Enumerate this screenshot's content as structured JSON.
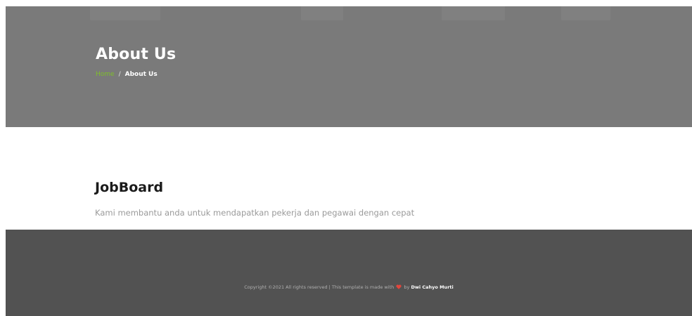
{
  "hero": {
    "title": "About Us",
    "breadcrumb": {
      "home": "Home",
      "separator": "/",
      "current": "About Us"
    }
  },
  "main": {
    "brand": "JobBoard",
    "tagline": "Kami membantu anda untuk mendapatkan pekerja dan pegawai dengan cepat"
  },
  "footer": {
    "copyright_prefix": "Copyright ©2021 All rights reserved | This template is made with",
    "heart_icon": "heart-icon",
    "by_text": "by",
    "author": "Dwi Cahyo Murti"
  },
  "colors": {
    "hero_bg": "#7a7a7a",
    "accent": "#7fbf2a",
    "footer_bg": "#525252",
    "heart": "#e2453c"
  }
}
